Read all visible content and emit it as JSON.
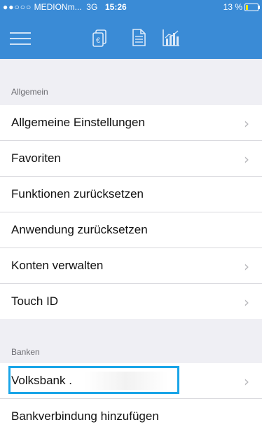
{
  "statusbar": {
    "signal": "●●○○○",
    "carrier": "MEDIONm...",
    "network": "3G",
    "time": "15:26",
    "battery": "13 %"
  },
  "toolbar": {
    "icons": [
      "menu-icon",
      "money-card-icon",
      "document-icon",
      "chart-icon"
    ],
    "accent": "#3a8bd6"
  },
  "sections": {
    "allgemein": {
      "title": "Allgemein",
      "items": [
        {
          "label": "Allgemeine Einstellungen",
          "chevron": true
        },
        {
          "label": "Favoriten",
          "chevron": true
        },
        {
          "label": "Funktionen zurücksetzen",
          "chevron": false
        },
        {
          "label": "Anwendung zurücksetzen",
          "chevron": false
        },
        {
          "label": "Konten verwalten",
          "chevron": true
        },
        {
          "label": "Touch ID",
          "chevron": true
        }
      ]
    },
    "banken": {
      "title": "Banken",
      "items": [
        {
          "label": "Volksbank .",
          "chevron": true,
          "highlighted": true
        },
        {
          "label": "Bankverbindung hinzufügen",
          "chevron": false
        }
      ]
    }
  },
  "chevron_glyph": "›"
}
